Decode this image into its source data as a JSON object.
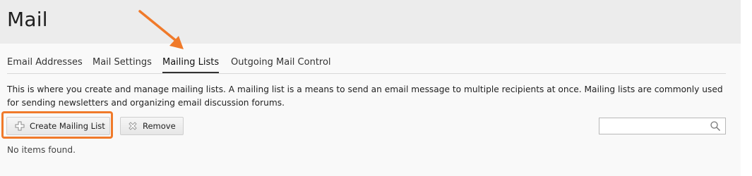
{
  "header": {
    "title": "Mail"
  },
  "tabs": [
    {
      "label": "Email Addresses",
      "active": false
    },
    {
      "label": "Mail Settings",
      "active": false
    },
    {
      "label": "Mailing Lists",
      "active": true
    },
    {
      "label": "Outgoing Mail Control",
      "active": false
    }
  ],
  "description": "This is where you create and manage mailing lists. A mailing list is a means to send an email message to multiple recipients at once. Mailing lists are commonly used for sending newsletters and organizing email discussion forums.",
  "toolbar": {
    "create_label": "Create Mailing List",
    "create_icon": "plus-icon",
    "remove_label": "Remove",
    "remove_icon": "x-icon"
  },
  "search": {
    "placeholder": "",
    "value": "",
    "icon": "search-icon"
  },
  "list": {
    "empty_text": "No items found."
  },
  "annotation": {
    "color": "#f07a2a"
  }
}
